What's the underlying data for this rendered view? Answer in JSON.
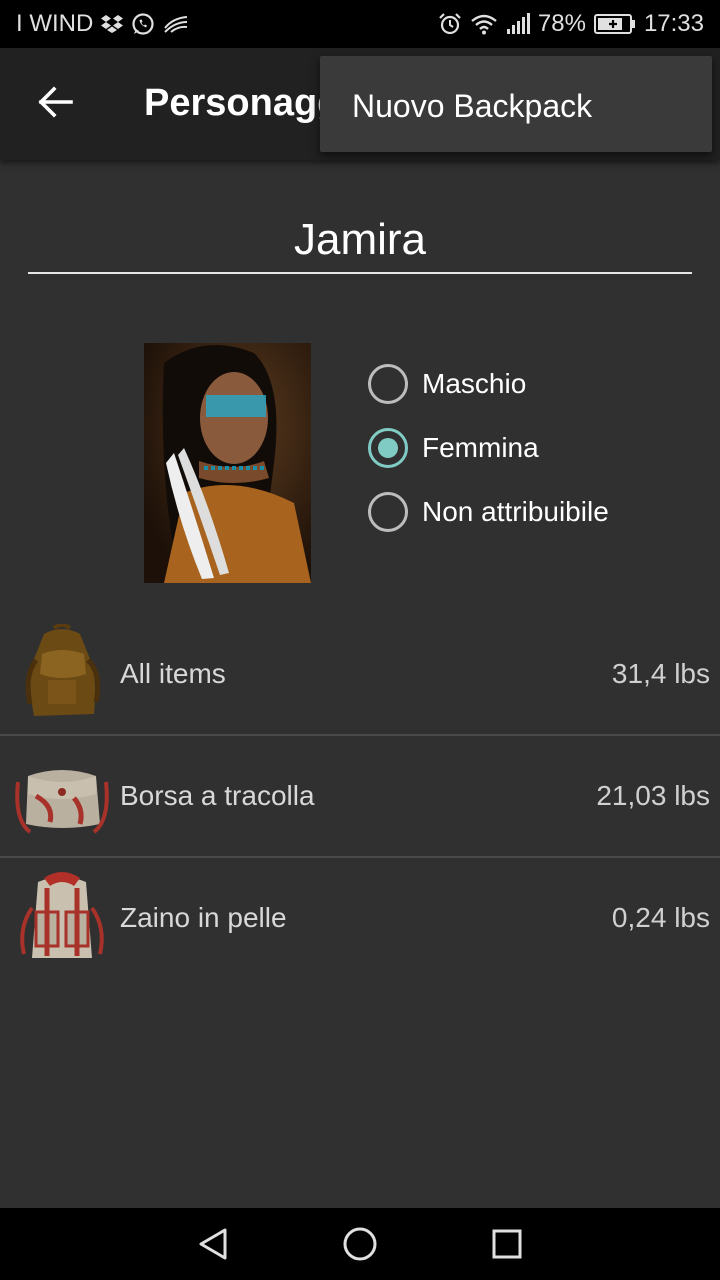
{
  "status_bar": {
    "carrier": "I WIND",
    "battery": "78%",
    "time": "17:33",
    "icons_left": [
      "dropbox-icon",
      "whatsapp-icon",
      "swype-icon"
    ],
    "icons_right": [
      "alarm-icon",
      "wifi-icon",
      "signal-icon",
      "battery-icon"
    ]
  },
  "app_bar": {
    "title": "Personaggio",
    "back_icon": "arrow-left-icon"
  },
  "overflow_menu": {
    "items": [
      {
        "label": "Nuovo Backpack"
      }
    ]
  },
  "character": {
    "name": "Jamira"
  },
  "gender": {
    "options": [
      {
        "label": "Maschio",
        "checked": false
      },
      {
        "label": "Femmina",
        "checked": true
      },
      {
        "label": "Non attribuibile",
        "checked": false
      }
    ],
    "accent": "#80cbc4"
  },
  "backpacks": [
    {
      "name": "All items",
      "weight": "31,4 lbs",
      "icon": "backpack-brown-icon"
    },
    {
      "name": "Borsa a tracolla",
      "weight": "21,03 lbs",
      "icon": "shoulder-bag-icon"
    },
    {
      "name": "Zaino in pelle",
      "weight": "0,24 lbs",
      "icon": "leather-backpack-icon"
    }
  ],
  "nav_bar": {
    "icons": [
      "back-triangle-icon",
      "home-circle-icon",
      "recents-square-icon"
    ]
  }
}
